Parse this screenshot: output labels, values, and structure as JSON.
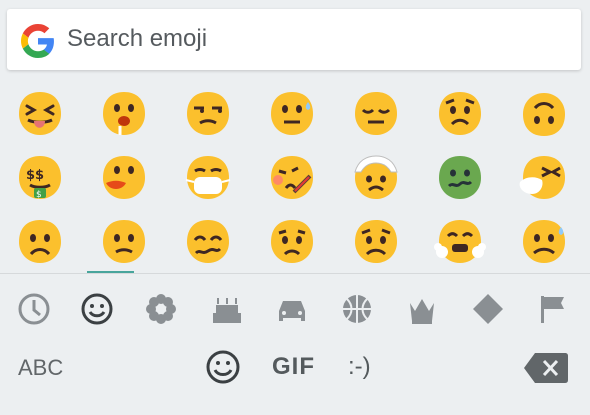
{
  "search": {
    "placeholder": "Search emoji"
  },
  "emoji_grid": {
    "rows": [
      [
        "squinting-tongue-face",
        "drooling-face",
        "unamused-face",
        "neutral-face-with-sweat",
        "relieved-face",
        "worried-face",
        "upside-down-face"
      ],
      [
        "money-mouth-face",
        "tongue-face",
        "face-with-medical-mask",
        "face-with-thermometer",
        "face-with-head-bandage",
        "nauseated-face",
        "sneezing-face"
      ],
      [
        "frowning-face",
        "slightly-frowning-face",
        "confounded-face",
        "sad-face",
        "worried-face",
        "steaming-face",
        "anguished-face"
      ]
    ]
  },
  "categories": [
    "recent-icon",
    "smileys-icon",
    "nature-icon",
    "food-icon",
    "travel-icon",
    "activity-icon",
    "objects-icon",
    "symbols-icon",
    "flags-icon"
  ],
  "active_category": "smileys-icon",
  "bottom_bar": {
    "abc_label": "ABC",
    "gif_label": "GIF",
    "emoticon_label": ":-)"
  },
  "colors": {
    "emoji_yellow": "#fbc02d",
    "accent": "#48a59c",
    "icon_gray": "#8a8f93"
  }
}
